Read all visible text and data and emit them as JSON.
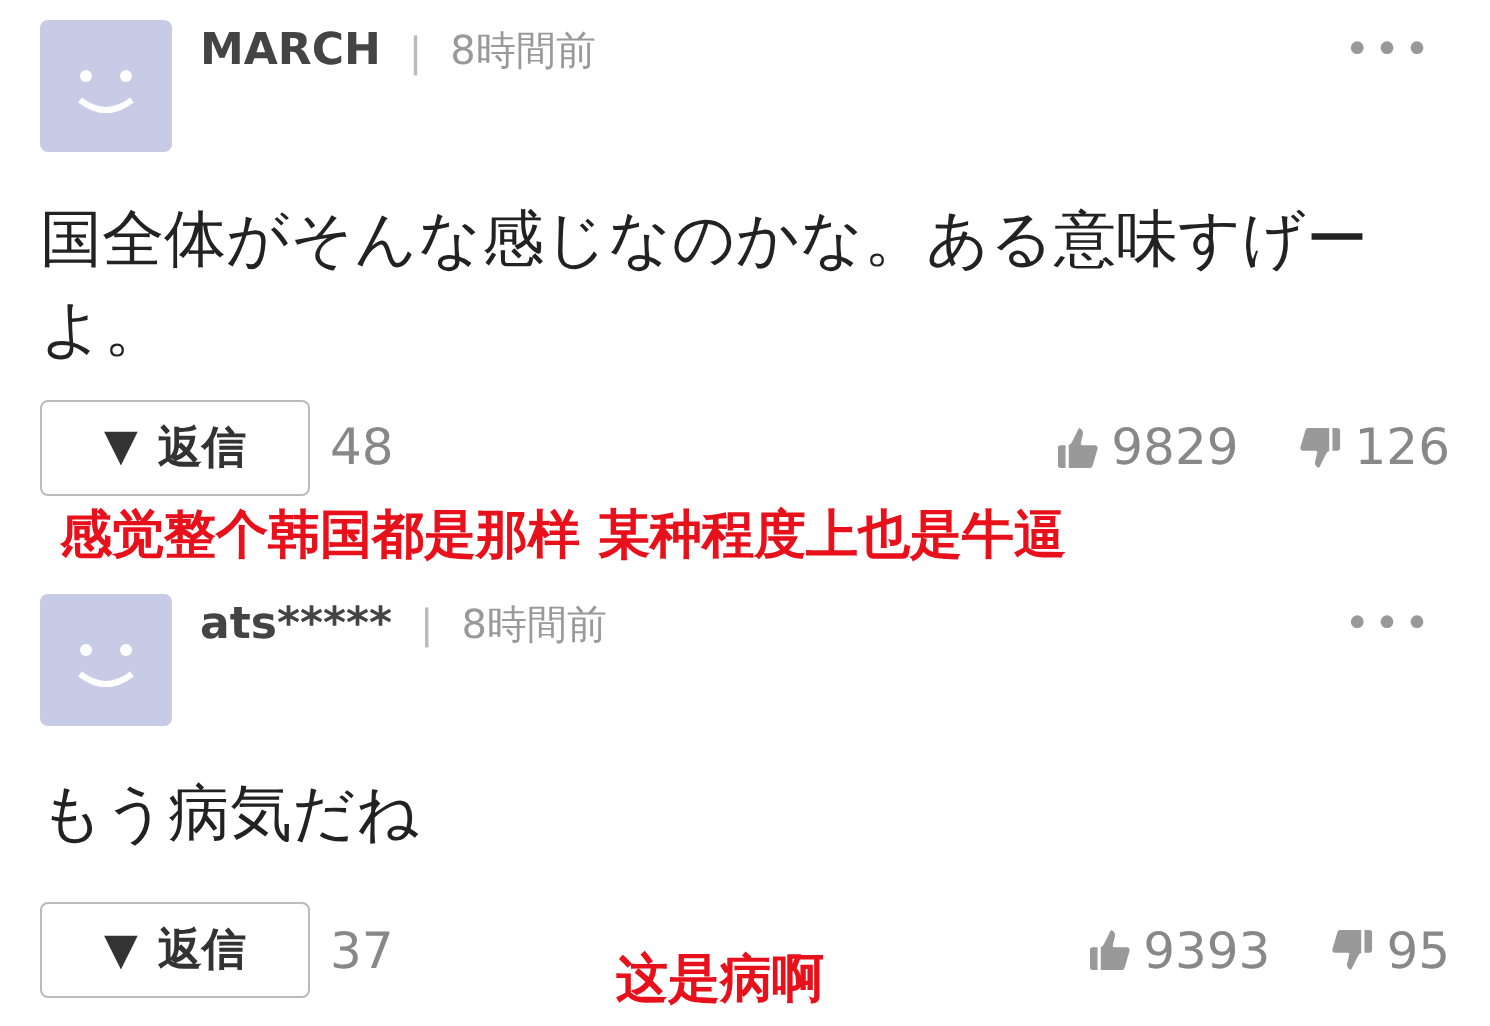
{
  "comments": [
    {
      "user": "MARCH",
      "separator": "|",
      "time": "8時間前",
      "more": "•••",
      "text": "国全体がそんな感じなのかな。ある意味すげーよ。",
      "reply_caret": "▼",
      "reply_label": "返信",
      "reply_count": "48",
      "likes": "9829",
      "dislikes": "126",
      "translation": "感觉整个韩国都是那样 某种程度上也是牛逼"
    },
    {
      "user": "ats*****",
      "separator": "|",
      "time": "8時間前",
      "more": "•••",
      "text": "もう病気だね",
      "reply_caret": "▼",
      "reply_label": "返信",
      "reply_count": "37",
      "likes": "9393",
      "dislikes": "95",
      "translation": "这是病啊"
    }
  ]
}
